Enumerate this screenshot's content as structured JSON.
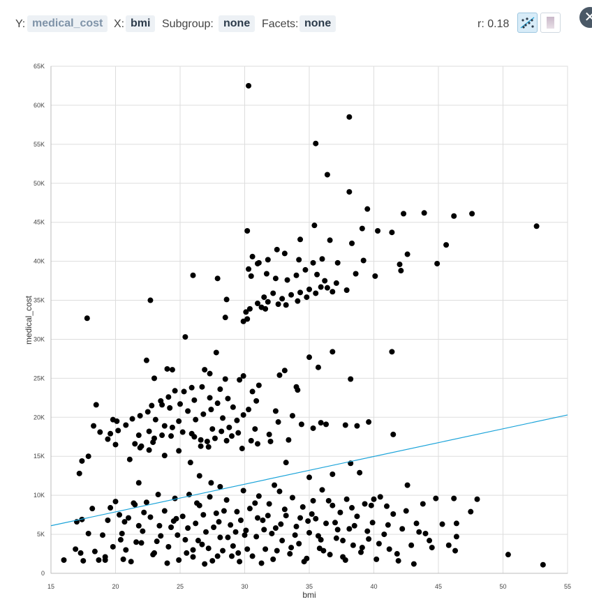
{
  "toolbar": {
    "y_label": "Y:",
    "y_value": "medical_cost",
    "x_label": "X:",
    "x_value": "bmi",
    "subgroup_label": "Subgroup:",
    "subgroup_value": "none",
    "facets_label": "Facets:",
    "facets_value": "none",
    "r_text": "r: 0.18",
    "scatter_icon": "scatter-plot-icon",
    "density_icon": "density-plot-icon",
    "close_icon": "close-icon"
  },
  "colors": {
    "point": "#000000",
    "trend": "#1aa3d9",
    "grid": "#dddddd",
    "chip_bg": "#edf1f5"
  },
  "chart_data": {
    "type": "scatter",
    "xlabel": "bmi",
    "ylabel": "medical_cost",
    "xlim": [
      15,
      55
    ],
    "ylim": [
      0,
      65000
    ],
    "x_ticks": [
      "15",
      "20",
      "25",
      "30",
      "35",
      "40",
      "45",
      "50",
      "55"
    ],
    "y_ticks": [
      "0",
      "5K",
      "10K",
      "15K",
      "20K",
      "25K",
      "30K",
      "35K",
      "40K",
      "45K",
      "50K",
      "55K",
      "60K",
      "65K"
    ],
    "grid": true,
    "trend_line": [
      [
        15,
        6100
      ],
      [
        55,
        20300
      ]
    ],
    "points": [
      [
        30.3,
        62500
      ],
      [
        38.1,
        58500
      ],
      [
        35.5,
        55100
      ],
      [
        36.4,
        51100
      ],
      [
        38.1,
        48900
      ],
      [
        39.5,
        46700
      ],
      [
        42.3,
        46100
      ],
      [
        43.9,
        46200
      ],
      [
        46.2,
        45800
      ],
      [
        47.6,
        46100
      ],
      [
        52.6,
        44500
      ],
      [
        30.2,
        43900
      ],
      [
        35.4,
        44600
      ],
      [
        34.3,
        42800
      ],
      [
        36.6,
        42700
      ],
      [
        38.3,
        42300
      ],
      [
        39.1,
        44200
      ],
      [
        40.3,
        43900
      ],
      [
        41.4,
        43700
      ],
      [
        45.6,
        42100
      ],
      [
        42.6,
        40900
      ],
      [
        42.0,
        39600
      ],
      [
        42.1,
        38800
      ],
      [
        44.9,
        39700
      ],
      [
        39.2,
        40100
      ],
      [
        38.6,
        38400
      ],
      [
        40.1,
        38100
      ],
      [
        37.2,
        39800
      ],
      [
        36.0,
        40300
      ],
      [
        35.3,
        39800
      ],
      [
        34.2,
        40200
      ],
      [
        33.1,
        41000
      ],
      [
        32.5,
        41500
      ],
      [
        31.8,
        40200
      ],
      [
        31.1,
        39800
      ],
      [
        30.6,
        40600
      ],
      [
        30.3,
        39000
      ],
      [
        30.5,
        38100
      ],
      [
        31.0,
        39700
      ],
      [
        31.7,
        38400
      ],
      [
        32.4,
        37800
      ],
      [
        33.3,
        37600
      ],
      [
        34.0,
        38200
      ],
      [
        34.7,
        38900
      ],
      [
        35.6,
        38300
      ],
      [
        36.2,
        37500
      ],
      [
        37.1,
        37200
      ],
      [
        37.9,
        36300
      ],
      [
        36.8,
        36100
      ],
      [
        35.9,
        36700
      ],
      [
        35.0,
        36400
      ],
      [
        34.3,
        36000
      ],
      [
        33.6,
        35700
      ],
      [
        32.9,
        35200
      ],
      [
        32.2,
        35900
      ],
      [
        31.5,
        35400
      ],
      [
        31.0,
        34600
      ],
      [
        31.3,
        34100
      ],
      [
        31.8,
        34800
      ],
      [
        32.6,
        34500
      ],
      [
        33.2,
        34400
      ],
      [
        34.1,
        34900
      ],
      [
        34.8,
        35400
      ],
      [
        35.5,
        35900
      ],
      [
        36.4,
        36600
      ],
      [
        30.4,
        33900
      ],
      [
        30.1,
        33500
      ],
      [
        29.9,
        32300
      ],
      [
        30.2,
        32600
      ],
      [
        31.6,
        33900
      ],
      [
        28.5,
        32800
      ],
      [
        28.6,
        35100
      ],
      [
        27.9,
        37800
      ],
      [
        26.0,
        38200
      ],
      [
        22.7,
        35000
      ],
      [
        17.8,
        32700
      ],
      [
        25.4,
        30300
      ],
      [
        27.8,
        28300
      ],
      [
        36.8,
        28400
      ],
      [
        41.4,
        28400
      ],
      [
        35.7,
        26400
      ],
      [
        35.0,
        27700
      ],
      [
        22.4,
        27300
      ],
      [
        24.0,
        26200
      ],
      [
        24.4,
        26100
      ],
      [
        26.9,
        26100
      ],
      [
        27.3,
        25600
      ],
      [
        29.9,
        25300
      ],
      [
        29.6,
        24800
      ],
      [
        28.5,
        24900
      ],
      [
        26.7,
        23900
      ],
      [
        25.9,
        23800
      ],
      [
        25.3,
        23300
      ],
      [
        24.6,
        23400
      ],
      [
        24.1,
        22600
      ],
      [
        23.5,
        22100
      ],
      [
        22.8,
        21500
      ],
      [
        23.0,
        25000
      ],
      [
        33.1,
        26000
      ],
      [
        32.7,
        25400
      ],
      [
        38.2,
        24900
      ],
      [
        34.1,
        23500
      ],
      [
        31.1,
        24100
      ],
      [
        28.1,
        23600
      ],
      [
        27.3,
        22500
      ],
      [
        26.1,
        22200
      ],
      [
        25.0,
        21700
      ],
      [
        24.2,
        21200
      ],
      [
        23.6,
        21600
      ],
      [
        22.5,
        20700
      ],
      [
        21.9,
        20200
      ],
      [
        21.3,
        19800
      ],
      [
        20.8,
        19000
      ],
      [
        20.2,
        18300
      ],
      [
        19.6,
        17900
      ],
      [
        18.8,
        18100
      ],
      [
        18.3,
        18900
      ],
      [
        19.8,
        19700
      ],
      [
        20.1,
        19500
      ],
      [
        18.5,
        21600
      ],
      [
        17.4,
        14400
      ],
      [
        17.2,
        12800
      ],
      [
        17.9,
        15000
      ],
      [
        19.4,
        17200
      ],
      [
        20.0,
        16500
      ],
      [
        21.1,
        14600
      ],
      [
        22.0,
        16300
      ],
      [
        22.6,
        15800
      ],
      [
        23.0,
        17300
      ],
      [
        23.6,
        17700
      ],
      [
        24.3,
        17600
      ],
      [
        25.2,
        18100
      ],
      [
        25.9,
        17900
      ],
      [
        26.6,
        17100
      ],
      [
        27.1,
        16900
      ],
      [
        27.7,
        17300
      ],
      [
        28.2,
        18200
      ],
      [
        28.8,
        18700
      ],
      [
        29.4,
        19600
      ],
      [
        29.9,
        20300
      ],
      [
        30.3,
        21000
      ],
      [
        30.9,
        22100
      ],
      [
        29.1,
        21300
      ],
      [
        28.7,
        22400
      ],
      [
        27.9,
        21800
      ],
      [
        27.4,
        21000
      ],
      [
        26.8,
        20400
      ],
      [
        26.2,
        19700
      ],
      [
        25.6,
        20800
      ],
      [
        24.9,
        19500
      ],
      [
        24.4,
        18700
      ],
      [
        23.8,
        18900
      ],
      [
        23.1,
        19700
      ],
      [
        22.6,
        18200
      ],
      [
        21.8,
        17700
      ],
      [
        21.5,
        16600
      ],
      [
        21.9,
        16100
      ],
      [
        22.9,
        16800
      ],
      [
        23.8,
        15100
      ],
      [
        24.9,
        15700
      ],
      [
        25.8,
        14200
      ],
      [
        26.6,
        16300
      ],
      [
        27.5,
        18500
      ],
      [
        28.3,
        19900
      ],
      [
        29.0,
        17600
      ],
      [
        29.8,
        16000
      ],
      [
        30.5,
        17000
      ],
      [
        31.0,
        16600
      ],
      [
        31.9,
        17800
      ],
      [
        32.6,
        19400
      ],
      [
        33.4,
        17100
      ],
      [
        34.0,
        23900
      ],
      [
        34.4,
        19100
      ],
      [
        35.3,
        18600
      ],
      [
        35.9,
        19300
      ],
      [
        37.8,
        19000
      ],
      [
        39.6,
        19400
      ],
      [
        41.5,
        17800
      ],
      [
        32.0,
        16900
      ],
      [
        30.8,
        18500
      ],
      [
        29.5,
        18000
      ],
      [
        28.6,
        17000
      ],
      [
        27.2,
        16200
      ],
      [
        26.1,
        17500
      ],
      [
        33.7,
        20200
      ],
      [
        32.4,
        20800
      ],
      [
        30.6,
        23300
      ],
      [
        36.3,
        19100
      ],
      [
        38.7,
        18900
      ],
      [
        33.2,
        14200
      ],
      [
        36.8,
        12700
      ],
      [
        38.2,
        14100
      ],
      [
        38.9,
        12900
      ],
      [
        35.0,
        12300
      ],
      [
        32.3,
        11300
      ],
      [
        28.1,
        11100
      ],
      [
        27.4,
        11600
      ],
      [
        26.5,
        12500
      ],
      [
        21.8,
        11600
      ],
      [
        16.0,
        1700
      ],
      [
        16.9,
        3100
      ],
      [
        17.3,
        2600
      ],
      [
        17.5,
        1600
      ],
      [
        17.0,
        6600
      ],
      [
        17.4,
        6900
      ],
      [
        17.9,
        5100
      ],
      [
        18.4,
        2800
      ],
      [
        18.7,
        1700
      ],
      [
        19.0,
        4900
      ],
      [
        19.4,
        6800
      ],
      [
        19.6,
        8400
      ],
      [
        20.0,
        9200
      ],
      [
        20.3,
        7500
      ],
      [
        20.5,
        5100
      ],
      [
        20.8,
        3000
      ],
      [
        21.2,
        1500
      ],
      [
        21.5,
        8800
      ],
      [
        21.8,
        6100
      ],
      [
        22.0,
        3900
      ],
      [
        22.4,
        9100
      ],
      [
        22.7,
        7200
      ],
      [
        23.0,
        2600
      ],
      [
        23.3,
        10100
      ],
      [
        23.5,
        4800
      ],
      [
        23.8,
        8000
      ],
      [
        24.1,
        3400
      ],
      [
        24.3,
        5900
      ],
      [
        24.6,
        9600
      ],
      [
        24.9,
        1700
      ],
      [
        25.2,
        7300
      ],
      [
        25.4,
        4300
      ],
      [
        25.7,
        10100
      ],
      [
        26.0,
        2100
      ],
      [
        26.2,
        6400
      ],
      [
        26.5,
        8700
      ],
      [
        26.7,
        3700
      ],
      [
        27.0,
        5300
      ],
      [
        27.3,
        9800
      ],
      [
        27.5,
        1600
      ],
      [
        27.8,
        7700
      ],
      [
        28.1,
        4600
      ],
      [
        28.3,
        2900
      ],
      [
        28.6,
        9400
      ],
      [
        28.9,
        6200
      ],
      [
        29.1,
        3500
      ],
      [
        29.4,
        7900
      ],
      [
        29.6,
        1500
      ],
      [
        29.9,
        10600
      ],
      [
        30.1,
        5500
      ],
      [
        30.4,
        8300
      ],
      [
        30.6,
        2200
      ],
      [
        30.9,
        4700
      ],
      [
        31.1,
        9900
      ],
      [
        31.4,
        6800
      ],
      [
        31.6,
        3100
      ],
      [
        31.9,
        8900
      ],
      [
        32.2,
        1800
      ],
      [
        32.4,
        5800
      ],
      [
        32.7,
        10500
      ],
      [
        32.9,
        4200
      ],
      [
        33.2,
        7400
      ],
      [
        33.5,
        2500
      ],
      [
        33.7,
        9700
      ],
      [
        34.0,
        6000
      ],
      [
        34.2,
        3800
      ],
      [
        34.5,
        8500
      ],
      [
        34.8,
        1900
      ],
      [
        35.0,
        5200
      ],
      [
        35.3,
        9300
      ],
      [
        35.5,
        7000
      ],
      [
        35.8,
        3200
      ],
      [
        36.0,
        10700
      ],
      [
        36.3,
        6400
      ],
      [
        36.6,
        2400
      ],
      [
        36.8,
        8700
      ],
      [
        37.1,
        4500
      ],
      [
        37.4,
        7800
      ],
      [
        37.6,
        2100
      ],
      [
        37.9,
        9500
      ],
      [
        38.1,
        5700
      ],
      [
        38.4,
        3600
      ],
      [
        38.7,
        7300
      ],
      [
        39.0,
        2700
      ],
      [
        39.3,
        8900
      ],
      [
        39.6,
        4400
      ],
      [
        39.9,
        6500
      ],
      [
        40.2,
        1800
      ],
      [
        40.5,
        9800
      ],
      [
        40.8,
        5000
      ],
      [
        41.2,
        3100
      ],
      [
        41.5,
        7600
      ],
      [
        41.9,
        1600
      ],
      [
        42.2,
        5700
      ],
      [
        42.6,
        11300
      ],
      [
        42.9,
        3600
      ],
      [
        43.3,
        6400
      ],
      [
        43.8,
        8900
      ],
      [
        44.3,
        4200
      ],
      [
        44.8,
        9600
      ],
      [
        45.3,
        6300
      ],
      [
        45.8,
        3600
      ],
      [
        46.2,
        9600
      ],
      [
        46.4,
        6400
      ],
      [
        46.4,
        4700
      ],
      [
        46.3,
        2900
      ],
      [
        47.5,
        7900
      ],
      [
        48.0,
        9500
      ],
      [
        50.4,
        2400
      ],
      [
        53.1,
        1100
      ],
      [
        18.2,
        8300
      ],
      [
        19.2,
        2100
      ],
      [
        20.7,
        6600
      ],
      [
        21.6,
        4000
      ],
      [
        22.2,
        7800
      ],
      [
        23.4,
        6100
      ],
      [
        24.0,
        1300
      ],
      [
        24.7,
        7000
      ],
      [
        25.5,
        2600
      ],
      [
        26.3,
        9000
      ],
      [
        26.9,
        1200
      ],
      [
        27.6,
        5900
      ],
      [
        28.4,
        8000
      ],
      [
        29.0,
        2200
      ],
      [
        29.7,
        6800
      ],
      [
        30.2,
        3100
      ],
      [
        30.8,
        9000
      ],
      [
        31.3,
        1300
      ],
      [
        31.8,
        7400
      ],
      [
        32.5,
        2900
      ],
      [
        33.1,
        8200
      ],
      [
        33.9,
        4900
      ],
      [
        34.6,
        1500
      ],
      [
        35.2,
        7600
      ],
      [
        35.9,
        4300
      ],
      [
        36.5,
        9300
      ],
      [
        37.2,
        5600
      ],
      [
        37.8,
        1700
      ],
      [
        38.5,
        6100
      ],
      [
        39.1,
        3300
      ],
      [
        39.8,
        8700
      ],
      [
        40.4,
        3800
      ],
      [
        41.1,
        6200
      ],
      [
        41.8,
        2500
      ],
      [
        42.5,
        8000
      ],
      [
        43.1,
        1200
      ],
      [
        44.0,
        5100
      ],
      [
        26.4,
        4200
      ],
      [
        27.2,
        3200
      ],
      [
        28.7,
        4600
      ],
      [
        30.0,
        4900
      ],
      [
        31.5,
        5600
      ],
      [
        32.8,
        6300
      ],
      [
        34.3,
        7100
      ],
      [
        35.7,
        4800
      ],
      [
        37.0,
        6500
      ],
      [
        38.3,
        8400
      ],
      [
        29.3,
        5300
      ],
      [
        28.0,
        6600
      ],
      [
        26.8,
        7500
      ],
      [
        25.6,
        5800
      ],
      [
        24.5,
        6700
      ],
      [
        23.2,
        4100
      ],
      [
        22.1,
        5400
      ],
      [
        21.0,
        7100
      ],
      [
        20.4,
        4300
      ],
      [
        19.8,
        3400
      ],
      [
        31.0,
        7100
      ],
      [
        32.1,
        5100
      ],
      [
        33.6,
        3300
      ],
      [
        34.9,
        6700
      ],
      [
        36.1,
        2900
      ],
      [
        29.5,
        2600
      ],
      [
        27.9,
        2200
      ],
      [
        26.0,
        3000
      ],
      [
        24.8,
        4900
      ],
      [
        22.9,
        2400
      ],
      [
        21.4,
        9000
      ],
      [
        20.6,
        1800
      ],
      [
        19.2,
        1700
      ],
      [
        37.6,
        4200
      ],
      [
        39.5,
        5400
      ],
      [
        40.0,
        9500
      ],
      [
        41.0,
        8600
      ],
      [
        43.5,
        5300
      ],
      [
        44.5,
        3300
      ]
    ]
  }
}
